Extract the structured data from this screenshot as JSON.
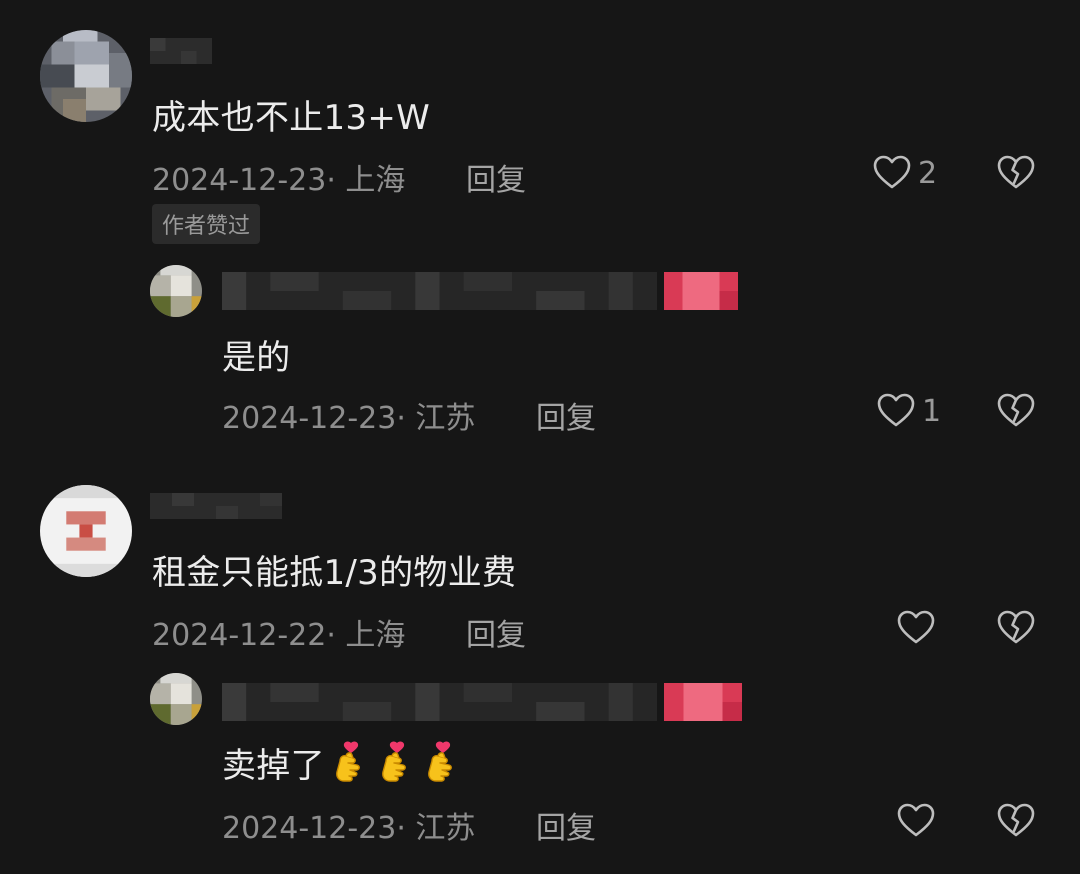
{
  "comments": [
    {
      "text": "成本也不止13+W",
      "meta": "2024-12-23· 上海",
      "reply": "回复",
      "likes": "2",
      "badge": "作者赞过",
      "replies": [
        {
          "text": "是的",
          "meta": "2024-12-23· 江苏",
          "reply": "回复",
          "likes": "1"
        }
      ]
    },
    {
      "text": "租金只能抵1/3的物业费",
      "meta": "2024-12-22· 上海",
      "reply": "回复",
      "likes": "",
      "replies": [
        {
          "text": "卖掉了",
          "emoji": [
            "finger-heart-emoji",
            "finger-heart-emoji",
            "finger-heart-emoji"
          ],
          "meta": "2024-12-23· 江苏",
          "reply": "回复",
          "likes": ""
        }
      ]
    }
  ],
  "icons": {
    "like": "heart-outline-icon",
    "dislike": "broken-heart-icon"
  },
  "colors": {
    "background": "#161616",
    "author_tag": "#e8425a",
    "meta": "#8e8e8e"
  }
}
